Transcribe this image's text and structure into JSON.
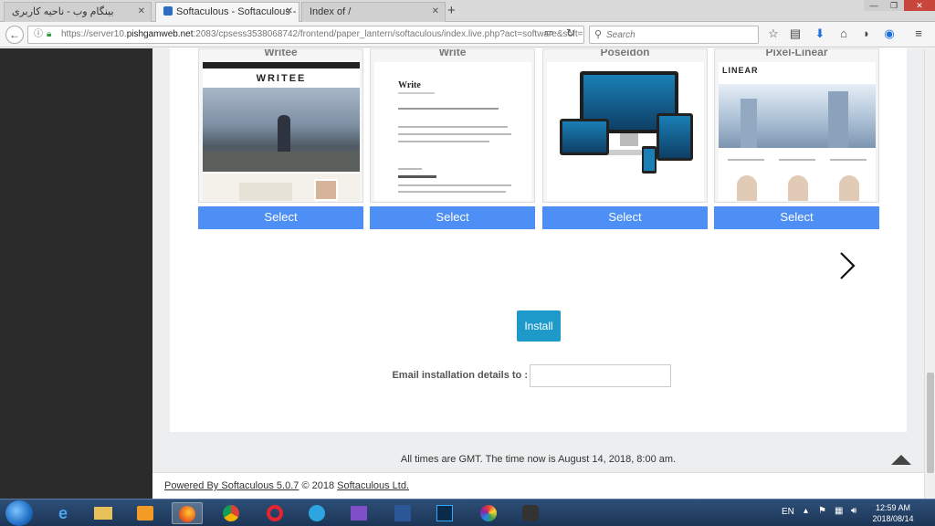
{
  "browser": {
    "tabs": [
      {
        "label": "بینگام وب - ناحیه کاربری",
        "active": false
      },
      {
        "label": "Softaculous - Softaculous - W",
        "active": true
      },
      {
        "label": "Index of /",
        "active": false
      }
    ],
    "new_tab": "+",
    "url_prefix": "https://server10.",
    "url_host": "pishgamweb.net",
    "url_rest": ":2083/cpsess3538068742/frontend/paper_lantern/softaculous/index.live.php?act=software&soft=",
    "search_placeholder": "Search",
    "window_controls": {
      "min": "—",
      "max": "❐",
      "close": "✕"
    }
  },
  "themes": [
    {
      "name": "Writee",
      "logo": "WRITEE",
      "select_label": "Select"
    },
    {
      "name": "Write",
      "logo": "Write",
      "select_label": "Select"
    },
    {
      "name": "Poseidon",
      "select_label": "Select"
    },
    {
      "name": "Pixel-Linear",
      "logo": "LINEAR",
      "select_label": "Select"
    }
  ],
  "install": {
    "button_label": "Install",
    "email_label": "Email installation details to :",
    "email_value": ""
  },
  "time_text": "All times are GMT. The time now is August 14, 2018, 8:00 am.",
  "footer": {
    "powered_by": "Powered By Softaculous 5.0.7",
    "copyright": "© 2018",
    "company": "Softaculous Ltd."
  },
  "taskbar": {
    "language": "EN",
    "time": "12:59 AM",
    "date": "2018/08/14"
  },
  "colors": {
    "select_button": "#4d8ff5",
    "install_button": "#1d9ac9",
    "sidebar": "#2b2b2b"
  }
}
